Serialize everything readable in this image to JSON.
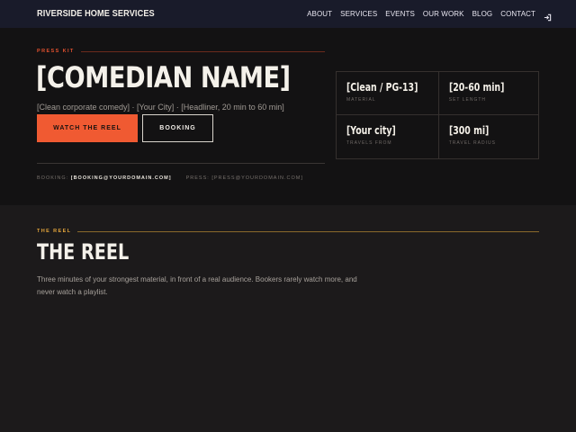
{
  "nav": {
    "brand": "RIVERSIDE HOME SERVICES",
    "items": [
      {
        "label": "ABOUT"
      },
      {
        "label": "SERVICES"
      },
      {
        "label": "EVENTS"
      },
      {
        "label": "OUR WORK"
      },
      {
        "label": "BLOG"
      },
      {
        "label": "CONTACT"
      }
    ],
    "login_icon": "login-icon"
  },
  "hero": {
    "kicker": "PRESS KIT",
    "title": "[COMEDIAN NAME]",
    "meta": "[Clean corporate comedy] · [Your City] · [Headliner, 20 min to 60 min]",
    "primary_button": "WATCH THE REEL",
    "secondary_button": "BOOKING",
    "booking_label": "BOOKING:",
    "booking_email": "[BOOKING@YOURDOMAIN.COM]",
    "press_label": "PRESS:",
    "press_email": "[PRESS@YOURDOMAIN.COM]"
  },
  "stats": [
    {
      "value": "[Clean / PG-13]",
      "label": "MATERIAL"
    },
    {
      "value": "[20-60 min]",
      "label": "SET LENGTH"
    },
    {
      "value": "[Your city]",
      "label": "TRAVELS FROM"
    },
    {
      "value": "[300 mi]",
      "label": "TRAVEL RADIUS"
    }
  ],
  "reel": {
    "kicker": "THE REEL",
    "title": "THE REEL",
    "description": "Three minutes of your strongest material, in front of a real audience. Bookers rarely watch more, and never watch a playlist."
  },
  "colors": {
    "accent": "#f05a32",
    "gold": "#e3a53b",
    "nav_bg": "#191b2a",
    "hero_bg": "#131213"
  }
}
